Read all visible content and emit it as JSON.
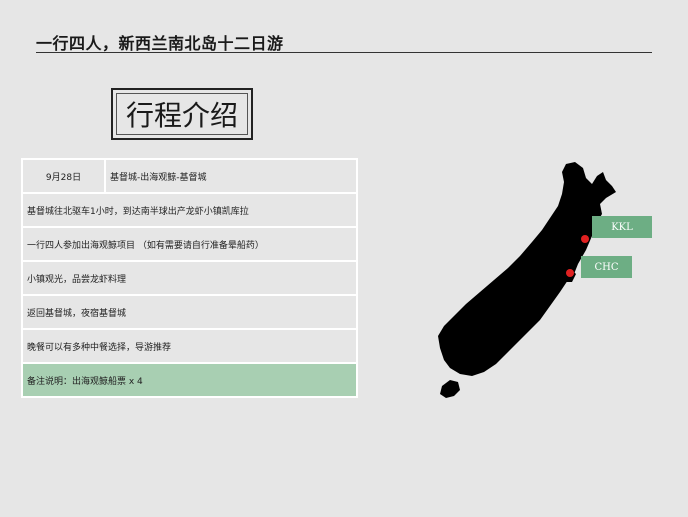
{
  "header": {
    "title": "一行四人，新西兰南北岛十二日游"
  },
  "section": {
    "title": "行程介绍"
  },
  "itinerary": {
    "date": "9月28日",
    "route": "基督城-出海观鲸-基督城",
    "rows": [
      "基督城往北驱车1小时，到达南半球出产龙虾小镇凯库拉",
      "一行四人参加出海观鲸项目 （如有需要请自行准备晕船药）",
      "小镇观光，品尝龙虾料理",
      "返回基督城，夜宿基督城",
      "晚餐可以有多种中餐选择，导游推荐"
    ],
    "note": "备注说明：出海观鲸船票 x 4"
  },
  "map": {
    "land_color": "#000000",
    "marker_color": "#e02020",
    "label_color": "#6dae84",
    "labels": {
      "kkl": "KKL",
      "chc": "CHC"
    }
  }
}
